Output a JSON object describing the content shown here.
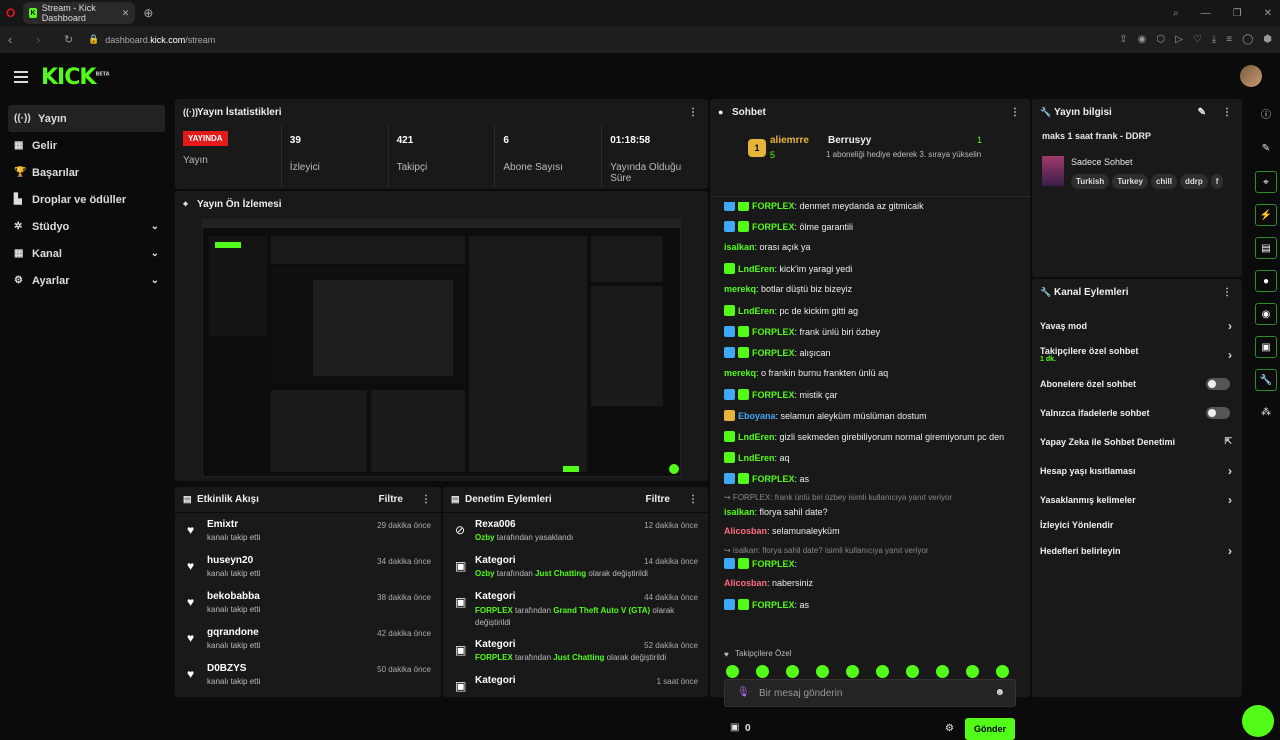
{
  "browser": {
    "tab_title": "Stream - Kick Dashboard",
    "url_prefix": "dashboard.",
    "url_host": "kick.com",
    "url_path": "/stream"
  },
  "logo": "KICK",
  "logo_badge": "BETA",
  "sidebar": {
    "items": [
      {
        "label": "Yayın",
        "icon": "broadcast-icon"
      },
      {
        "label": "Gelir",
        "icon": "money-icon"
      },
      {
        "label": "Başarılar",
        "icon": "trophy-icon"
      },
      {
        "label": "Droplar ve ödüller",
        "icon": "gift-icon"
      },
      {
        "label": "Stüdyo",
        "icon": "studio-icon"
      },
      {
        "label": "Kanal",
        "icon": "channel-icon"
      },
      {
        "label": "Ayarlar",
        "icon": "gear-icon"
      }
    ]
  },
  "stats": {
    "title": "Yayın İstatistikleri",
    "live": "YAYINDA",
    "live_label": "Yayın",
    "items": [
      {
        "value": "39",
        "label": "İzleyici"
      },
      {
        "value": "421",
        "label": "Takipçi"
      },
      {
        "value": "6",
        "label": "Abone Sayısı"
      },
      {
        "value": "01:18:58",
        "label": "Yayında Olduğu Süre"
      }
    ]
  },
  "preview": {
    "title": "Yayın Ön İzlemesi"
  },
  "events": {
    "title": "Etkinlik Akışı",
    "filter": "Filtre",
    "items": [
      {
        "name": "Emixtr",
        "sub": "kanalı takip etti",
        "time": "29 dakika önce"
      },
      {
        "name": "huseyn20",
        "sub": "kanalı takip etti",
        "time": "34 dakika önce"
      },
      {
        "name": "bekobabba",
        "sub": "kanalı takip etti",
        "time": "38 dakika önce"
      },
      {
        "name": "gqrandone",
        "sub": "kanalı takip etti",
        "time": "42 dakika önce"
      },
      {
        "name": "D0BZYS",
        "sub": "kanalı takip etti",
        "time": "50 dakika önce"
      }
    ]
  },
  "moderation": {
    "title": "Denetim Eylemleri",
    "filter": "Filtre",
    "items": [
      {
        "name": "Rexa006",
        "actor": "Ozby",
        "mid": " tarafından yasaklandı",
        "target": "",
        "end": "",
        "time": "12 dakika önce"
      },
      {
        "name": "Kategori",
        "actor": "Ozby",
        "mid": " tarafından ",
        "target": "Just Chatting",
        "end": " olarak değiştirildi",
        "time": "14 dakika önce"
      },
      {
        "name": "Kategori",
        "actor": "FORPLEX",
        "mid": " tarafından ",
        "target": "Grand Theft Auto V (GTA)",
        "end": " olarak değiştirildi",
        "time": "44 dakika önce"
      },
      {
        "name": "Kategori",
        "actor": "FORPLEX",
        "mid": " tarafından ",
        "target": "Just Chatting",
        "end": " olarak değiştirildi",
        "time": "52 dakika önce"
      },
      {
        "name": "Kategori",
        "actor": "",
        "mid": "",
        "target": "",
        "end": "",
        "time": "1 saat önce"
      }
    ]
  },
  "chat": {
    "title": "Sohbet",
    "pinned_user": "aliemrre",
    "pinned_count": "5",
    "gifter": "Berrusyy",
    "gift_count": "1",
    "gift_text": "1 aboneliği hediye ederek 3. sıraya yükselin",
    "messages": [
      {
        "user": "FORPLEX",
        "text": "denmet meydanda az gitmicaik",
        "color": "#53fc18"
      },
      {
        "user": "FORPLEX",
        "text": "ölme garantili",
        "color": "#53fc18"
      },
      {
        "user": "isalkan",
        "text": "orası açık ya",
        "color": "#53fc18"
      },
      {
        "user": "LndEren",
        "text": "kick'im yaragi yedi",
        "color": "#53fc18"
      },
      {
        "user": "merekq",
        "text": "botlar düştü biz bizeyiz",
        "color": "#53fc18"
      },
      {
        "user": "LndEren",
        "text": "pc de kickim gitti ag",
        "color": "#53fc18"
      },
      {
        "user": "FORPLEX",
        "text": "frank ünlü biri özbey",
        "color": "#53fc18"
      },
      {
        "user": "FORPLEX",
        "text": "alışıcan",
        "color": "#53fc18"
      },
      {
        "user": "merekq",
        "text": "o frankin burnu frankten ünlü aq",
        "color": "#53fc18"
      },
      {
        "user": "FORPLEX",
        "text": "mistik çar",
        "color": "#53fc18"
      },
      {
        "user": "Eboyana",
        "text": "selamun aleyküm müslüman dostum",
        "color": "#3fa9f5"
      },
      {
        "user": "LndEren",
        "text": "gizli sekmeden girebiliyorum normal giremiyorum pc den",
        "color": "#53fc18"
      },
      {
        "user": "LndEren",
        "text": "aq",
        "color": "#53fc18"
      },
      {
        "user": "FORPLEX",
        "text": "as",
        "color": "#53fc18"
      },
      {
        "reply": "FORPLEX: frank ünlü biri özbey isimli kullanıcıya yanıt veriyor"
      },
      {
        "user": "isalkan",
        "text": "florya sahil date?",
        "color": "#53fc18"
      },
      {
        "user": "Alicosban",
        "text": "selamunaleyküm",
        "color": "#ff6b81"
      },
      {
        "reply": "isalkan: florya sahil date? isimli kullanıcıya yanıt veriyor"
      },
      {
        "user": "FORPLEX",
        "text": "",
        "color": "#53fc18"
      },
      {
        "user": "Alicosban",
        "text": "nabersiniz",
        "color": "#ff6b81"
      },
      {
        "user": "FORPLEX",
        "text": "as",
        "color": "#53fc18"
      }
    ],
    "followers_only": "Takipçilere Özel",
    "placeholder": "Bir mesaj gönderin",
    "count": "0",
    "send": "Gönder"
  },
  "info": {
    "title": "Yayın bilgisi",
    "stream_title": "maks 1 saat frank - DDRP",
    "category": "Sadece Sohbet",
    "tags": [
      "Turkish",
      "Turkey",
      "chill",
      "ddrp",
      "f"
    ]
  },
  "actions": {
    "title": "Kanal Eylemleri",
    "items": [
      {
        "label": "Yavaş mod",
        "type": "chevron"
      },
      {
        "label": "Takipçilere özel sohbet",
        "sub": "1 dk.",
        "type": "chevron"
      },
      {
        "label": "Abonelere özel sohbet",
        "type": "toggle"
      },
      {
        "label": "Yalnızca ifadelerle sohbet",
        "type": "toggle"
      },
      {
        "label": "Yapay Zeka ile Sohbet Denetimi",
        "type": "external"
      },
      {
        "label": "Hesap yaşı kısıtlaması",
        "type": "chevron"
      },
      {
        "label": "Yasaklanmış kelimeler",
        "type": "chevron"
      },
      {
        "label": "İzleyici Yönlendir",
        "type": "none"
      },
      {
        "label": "Hedefleri belirleyin",
        "type": "chevron"
      }
    ]
  }
}
